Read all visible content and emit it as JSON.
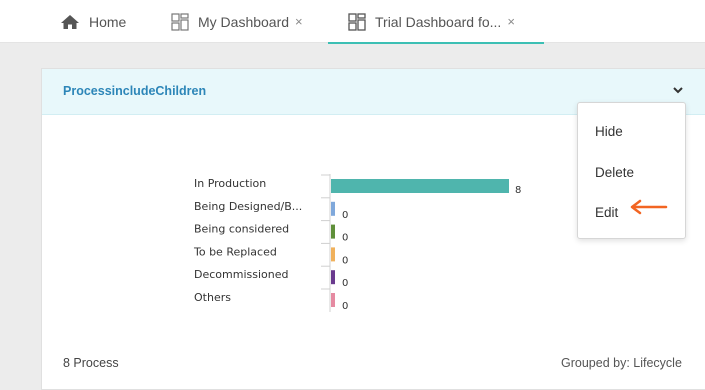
{
  "tabs": [
    {
      "label": "Home",
      "icon": "home-icon",
      "closable": false
    },
    {
      "label": "My Dashboard",
      "icon": "dashboard-icon",
      "closable": true
    },
    {
      "label": "Trial Dashboard fo...",
      "icon": "dashboard-icon",
      "closable": true,
      "active": true
    }
  ],
  "tab_close_glyph": "×",
  "widget": {
    "title": "ProcessincludeChildren",
    "footer_count": "8 Process",
    "footer_group": "Grouped by: Lifecycle"
  },
  "menu": {
    "items": [
      "Hide",
      "Delete",
      "Edit"
    ]
  },
  "colors": {
    "accent": "#3cbfb4",
    "title": "#2d86b8",
    "header_bg": "#e8f8fb",
    "annotation_arrow": "#f26522"
  },
  "chart_data": {
    "type": "bar",
    "orientation": "horizontal",
    "categories": [
      "In Production",
      "Being Designed/B...",
      "Being considered",
      "To be Replaced",
      "Decommissioned",
      "Others"
    ],
    "values": [
      8,
      0,
      0,
      0,
      0,
      0
    ],
    "value_labels": [
      "8",
      "0",
      "0",
      "0",
      "0",
      "0"
    ],
    "colors": [
      "#4fb5ad",
      "#7fa8db",
      "#5f8f3a",
      "#f0b15c",
      "#6a3a8e",
      "#e58aa1"
    ],
    "xlim": [
      0,
      8
    ],
    "grid": false
  }
}
